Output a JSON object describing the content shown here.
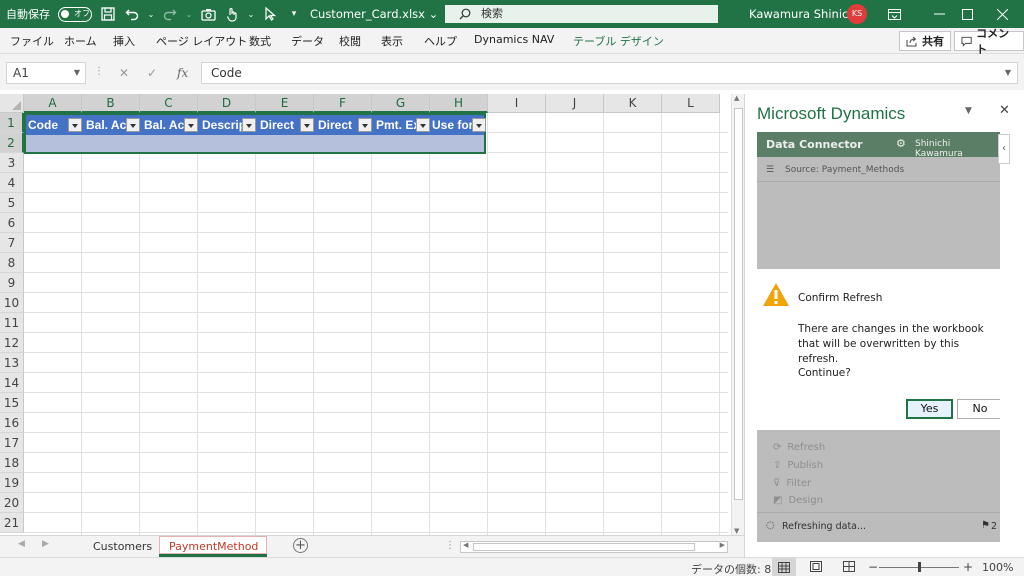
{
  "titlebar": {
    "autosave_label": "自動保存",
    "autosave_state": "オフ",
    "filename": "Customer_Card.xlsx",
    "search_placeholder": "検索",
    "user_name": "Kawamura Shinichi",
    "user_initials": "KS"
  },
  "ribbon": {
    "tabs": [
      "ファイル",
      "ホーム",
      "挿入",
      "ページ レイアウト",
      "数式",
      "データ",
      "校閲",
      "表示",
      "ヘルプ",
      "Dynamics NAV",
      "テーブル デザイン"
    ],
    "share_label": "共有",
    "comment_label": "コメント"
  },
  "formula_bar": {
    "name_box": "A1",
    "formula_value": "Code"
  },
  "grid": {
    "columns": [
      "A",
      "B",
      "C",
      "D",
      "E",
      "F",
      "G",
      "H",
      "I",
      "J",
      "K",
      "L"
    ],
    "rows": [
      "1",
      "2",
      "3",
      "4",
      "5",
      "6",
      "7",
      "8",
      "9",
      "10",
      "11",
      "12",
      "13",
      "14",
      "15",
      "16",
      "17",
      "18",
      "19",
      "20",
      "21"
    ],
    "table_headers": [
      "Code",
      "Bal. Ac",
      "Bal. Ac",
      "Descrip",
      "Direct",
      "Direct",
      "Pmt. Ex",
      "Use for"
    ]
  },
  "sheets": {
    "tabs": [
      "Customers",
      "PaymentMethod"
    ],
    "active": "PaymentMethod"
  },
  "statusbar": {
    "count_label": "データの個数: 8",
    "zoom": "100%"
  },
  "task_pane": {
    "title": "Microsoft Dynamics",
    "connector_title": "Data Connector",
    "connector_user": "Shinichi Kawamura",
    "source_label": "Source: Payment_Methods",
    "dialog": {
      "title": "Confirm Refresh",
      "message": "There are changes in the workbook that will be overwritten by this refresh.",
      "question": "Continue?",
      "yes_label": "Yes",
      "no_label": "No"
    },
    "menu": [
      "Refresh",
      "Publish",
      "Filter",
      "Design"
    ],
    "status_text": "Refreshing data...",
    "flag_count": "2"
  },
  "colors": {
    "excel_green": "#217346",
    "table_header_blue": "#4472c4",
    "warning_orange": "#f0a30a"
  }
}
